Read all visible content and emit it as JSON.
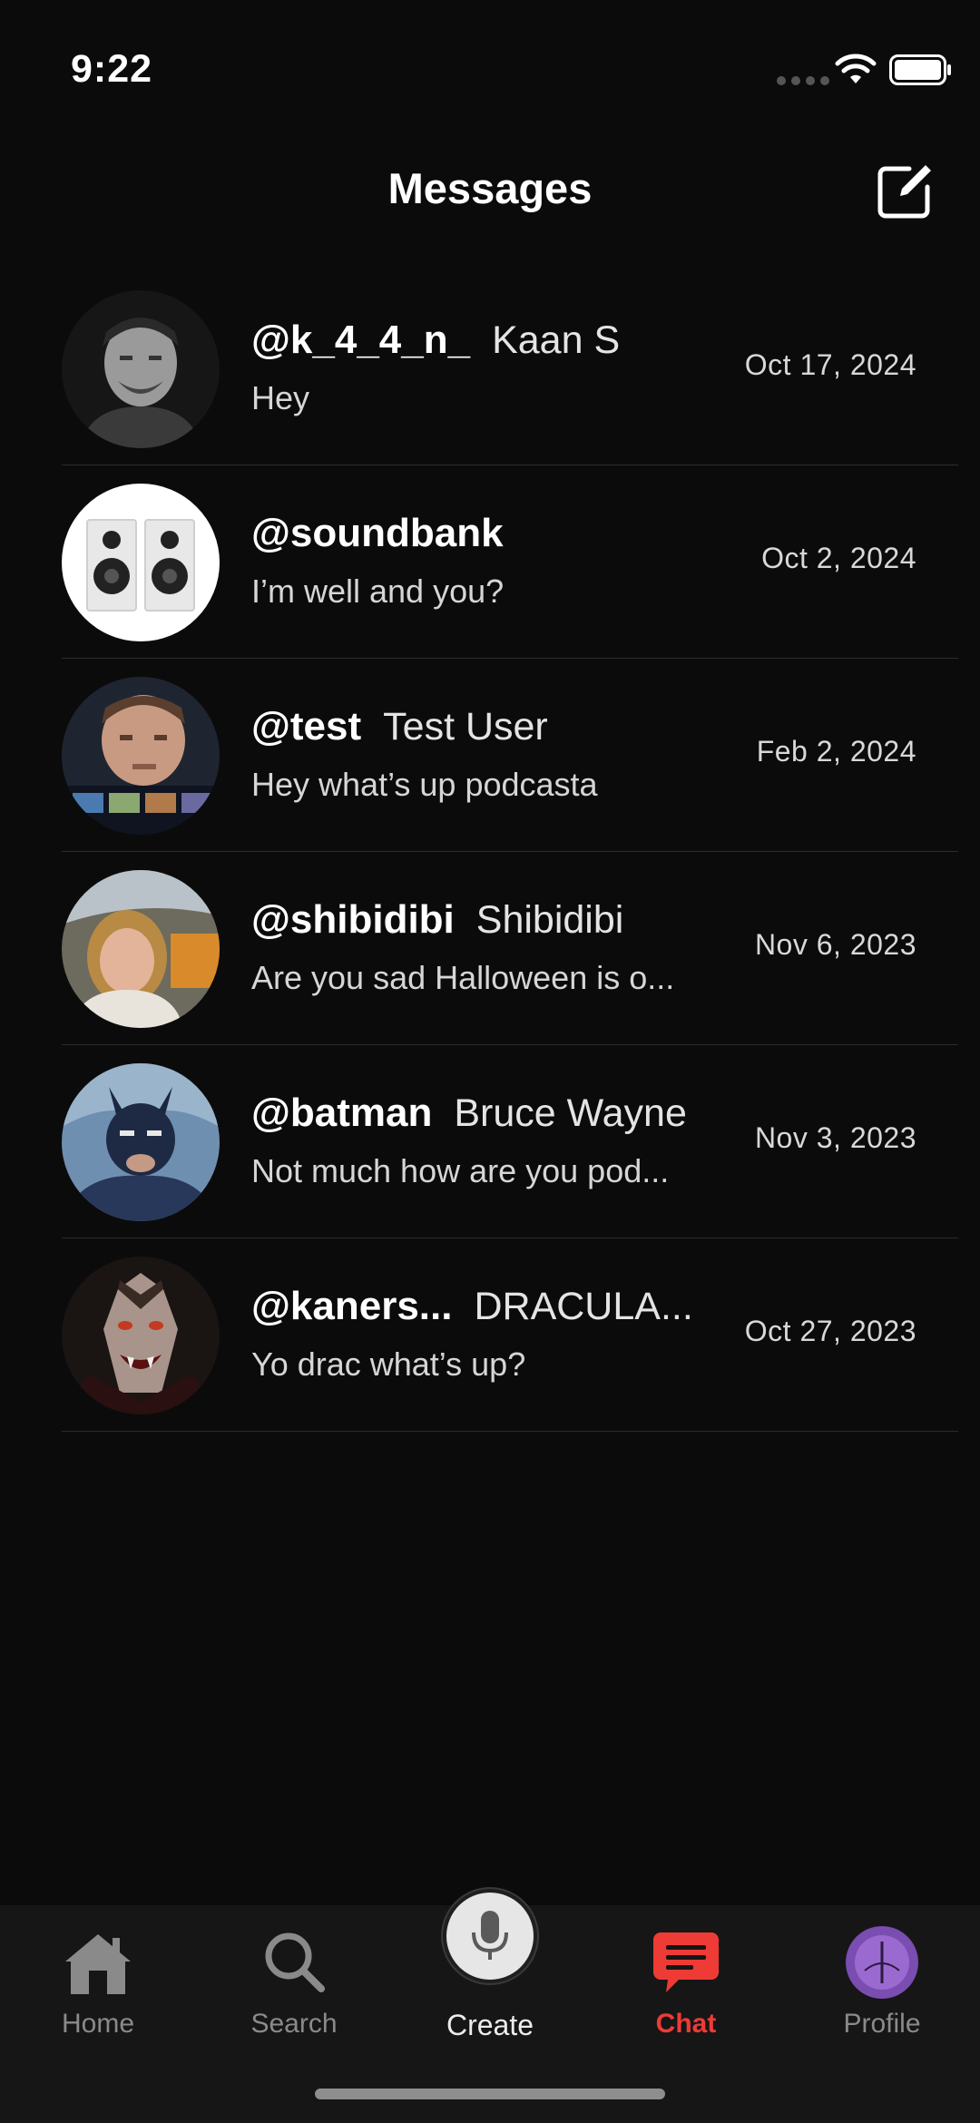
{
  "status_bar": {
    "time": "9:22"
  },
  "header": {
    "title": "Messages"
  },
  "conversations": [
    {
      "handle": "@k_4_4_n_",
      "name": "Kaan S",
      "preview": "Hey",
      "date": "Oct 17, 2024",
      "avatar": "man-bw-portrait"
    },
    {
      "handle": "@soundbank",
      "name": "",
      "preview": "I’m well and you?",
      "date": "Oct 2, 2024",
      "avatar": "speakers"
    },
    {
      "handle": "@test",
      "name": "Test User",
      "preview": "Hey what’s up podcasta",
      "date": "Feb 2, 2024",
      "avatar": "man-tv"
    },
    {
      "handle": "@shibidibi",
      "name": "Shibidibi",
      "preview": "Are you sad Halloween is o...",
      "date": "Nov 6, 2023",
      "avatar": "woman-selfie"
    },
    {
      "handle": "@batman",
      "name": "Bruce Wayne",
      "preview": "Not much how are you pod...",
      "date": "Nov 3, 2023",
      "avatar": "batman"
    },
    {
      "handle": "@kaners...",
      "name": "DRACULA...",
      "preview": "Yo drac what’s up?",
      "date": "Oct 27, 2023",
      "avatar": "dracula"
    }
  ],
  "tab_bar": {
    "home": "Home",
    "search": "Search",
    "create": "Create",
    "chat": "Chat",
    "profile": "Profile",
    "active": "chat",
    "active_color": "#ee3b35"
  }
}
